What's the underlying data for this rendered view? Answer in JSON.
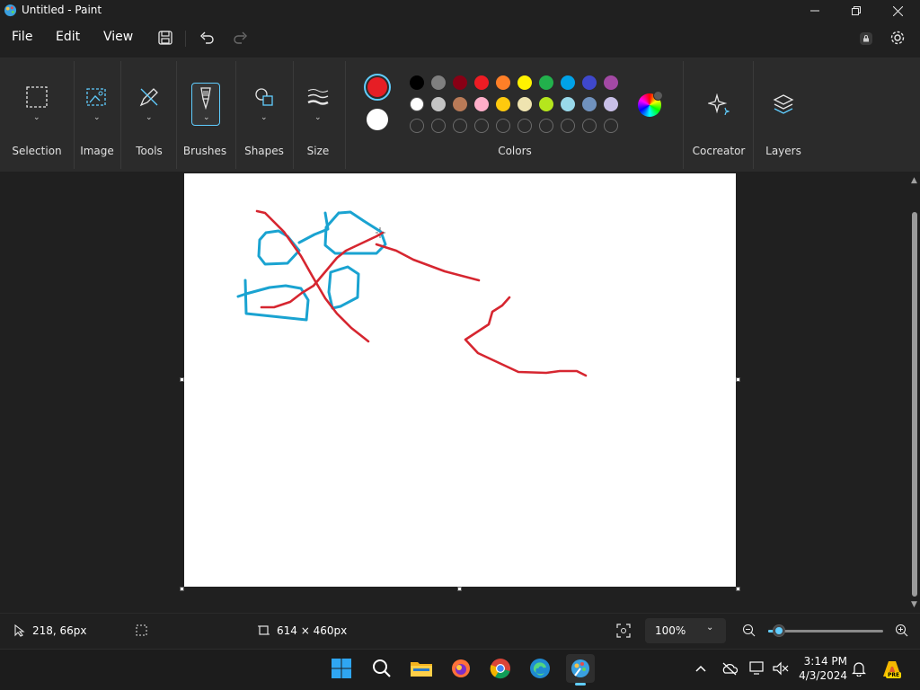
{
  "window": {
    "title": "Untitled - Paint",
    "minimize_icon": "minimize-icon",
    "maximize_icon": "restore-icon",
    "close_icon": "close-icon"
  },
  "menu": {
    "file": "File",
    "edit": "Edit",
    "view": "View"
  },
  "ribbon": {
    "groups": {
      "selection": "Selection",
      "image": "Image",
      "tools": "Tools",
      "brushes": "Brushes",
      "shapes": "Shapes",
      "size": "Size",
      "colors": "Colors",
      "cocreator": "Cocreator",
      "layers": "Layers"
    },
    "primary_color": "#e61e25",
    "secondary_color": "#ffffff",
    "palette_row1": [
      "#000000",
      "#7f7f7f",
      "#880015",
      "#ed1c24",
      "#ff7f27",
      "#fff200",
      "#22b14c",
      "#00a2e8",
      "#3f48cc",
      "#a349a4"
    ],
    "palette_row2": [
      "#ffffff",
      "#c3c3c3",
      "#b97a57",
      "#ffaec9",
      "#ffc90e",
      "#efe4b0",
      "#b5e61d",
      "#99d9ea",
      "#7092be",
      "#c8bfe7"
    ],
    "accent": "#60cdff"
  },
  "status": {
    "cursor_position": "218, 66px",
    "canvas_size": "614 × 460px",
    "zoom": "100%",
    "zoom_fraction": 0.09
  },
  "taskbar": {
    "time": "3:14 PM",
    "date": "4/3/2024",
    "badge": "PRE"
  }
}
